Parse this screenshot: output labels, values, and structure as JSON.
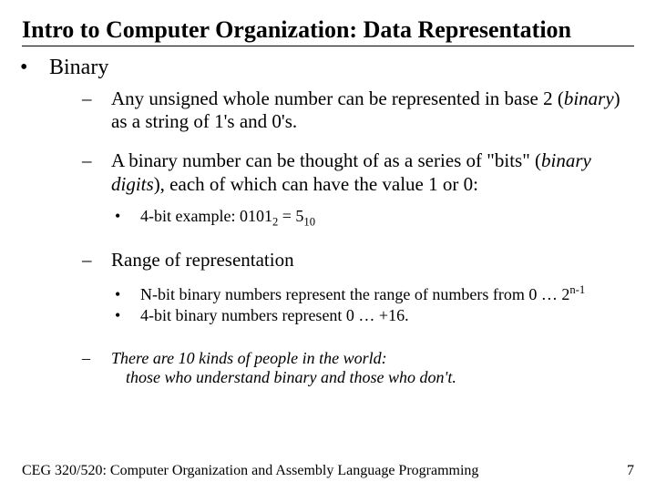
{
  "title": "Intro to Computer Organization: Data Representation",
  "section": "Binary",
  "items": [
    {
      "pre": "Any unsigned whole number can be represented in base 2 (",
      "ital": "binary",
      "post": ") as a string of 1's and 0's."
    },
    {
      "pre": "A binary number can be thought of as a series of \"bits\" (",
      "ital": "binary digits",
      "post": "), each of which can have the value 1 or 0:"
    }
  ],
  "example": {
    "label": "4-bit example: ",
    "lhs_base": "0101",
    "lhs_sub": "2",
    "eq": " = ",
    "rhs_base": "5",
    "rhs_sub": "10"
  },
  "range_head": "Range of representation",
  "range_sub1": {
    "pre": "N-bit binary numbers represent the range of numbers from 0 … 2",
    "sup": "n-1"
  },
  "range_sub2": "4-bit binary numbers represent 0 … +16.",
  "joke": {
    "l1": "There are 10 kinds of people in the world:",
    "l2": "those who understand binary and those who don't."
  },
  "footer": {
    "left": "CEG 320/520: Computer Organization and Assembly Language Programming",
    "right": "7"
  }
}
